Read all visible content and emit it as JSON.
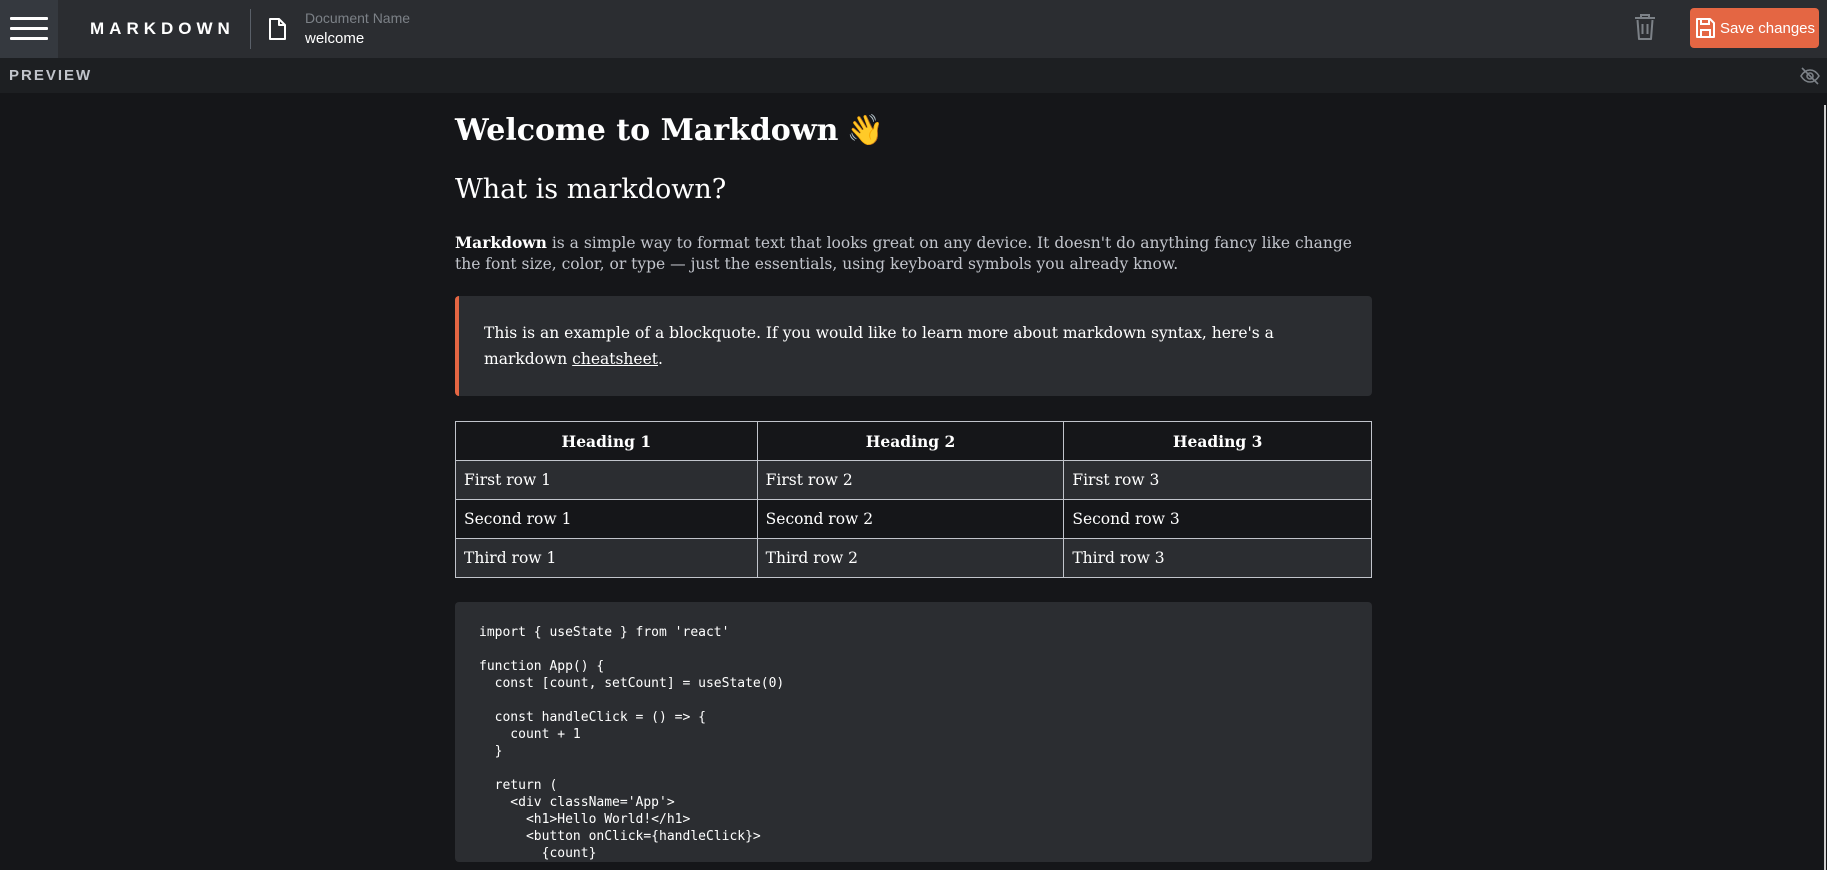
{
  "header": {
    "app_title": "MARKDOWN",
    "doc_label": "Document Name",
    "doc_name": "welcome",
    "save_label": "Save changes"
  },
  "preview": {
    "label": "PREVIEW"
  },
  "document": {
    "h1": "Welcome to Markdown",
    "h1_emoji": "👋",
    "h2": "What is markdown?",
    "para_bold": "Markdown",
    "para_rest": " is a simple way to format text that looks great on any device. It doesn't do anything fancy like change the font size, color, or type — just the essentials, using keyboard symbols you already know.",
    "blockquote_text": "This is an example of a blockquote. If you would like to learn more about markdown syntax, here's a markdown ",
    "blockquote_link": "cheatsheet",
    "blockquote_end": ".",
    "table": {
      "headers": [
        "Heading 1",
        "Heading 2",
        "Heading 3"
      ],
      "rows": [
        [
          "First row 1",
          "First row 2",
          "First row 3"
        ],
        [
          "Second row 1",
          "Second row 2",
          "Second row 3"
        ],
        [
          "Third row 1",
          "Third row 2",
          "Third row 3"
        ]
      ]
    },
    "code": "import { useState } from 'react'\n\nfunction App() {\n  const [count, setCount] = useState(0)\n\n  const handleClick = () => {\n    count + 1\n  }\n\n  return (\n    <div className='App'>\n      <h1>Hello World!</h1>\n      <button onClick={handleClick}>\n        {count}"
  },
  "colors": {
    "accent": "#e46643",
    "topbar": "#2b2d31",
    "background": "#151619"
  },
  "icons": {
    "menu": "hamburger-icon",
    "document": "document-icon",
    "delete": "trash-icon",
    "save": "save-icon",
    "preview_toggle": "eye-slash-icon"
  }
}
